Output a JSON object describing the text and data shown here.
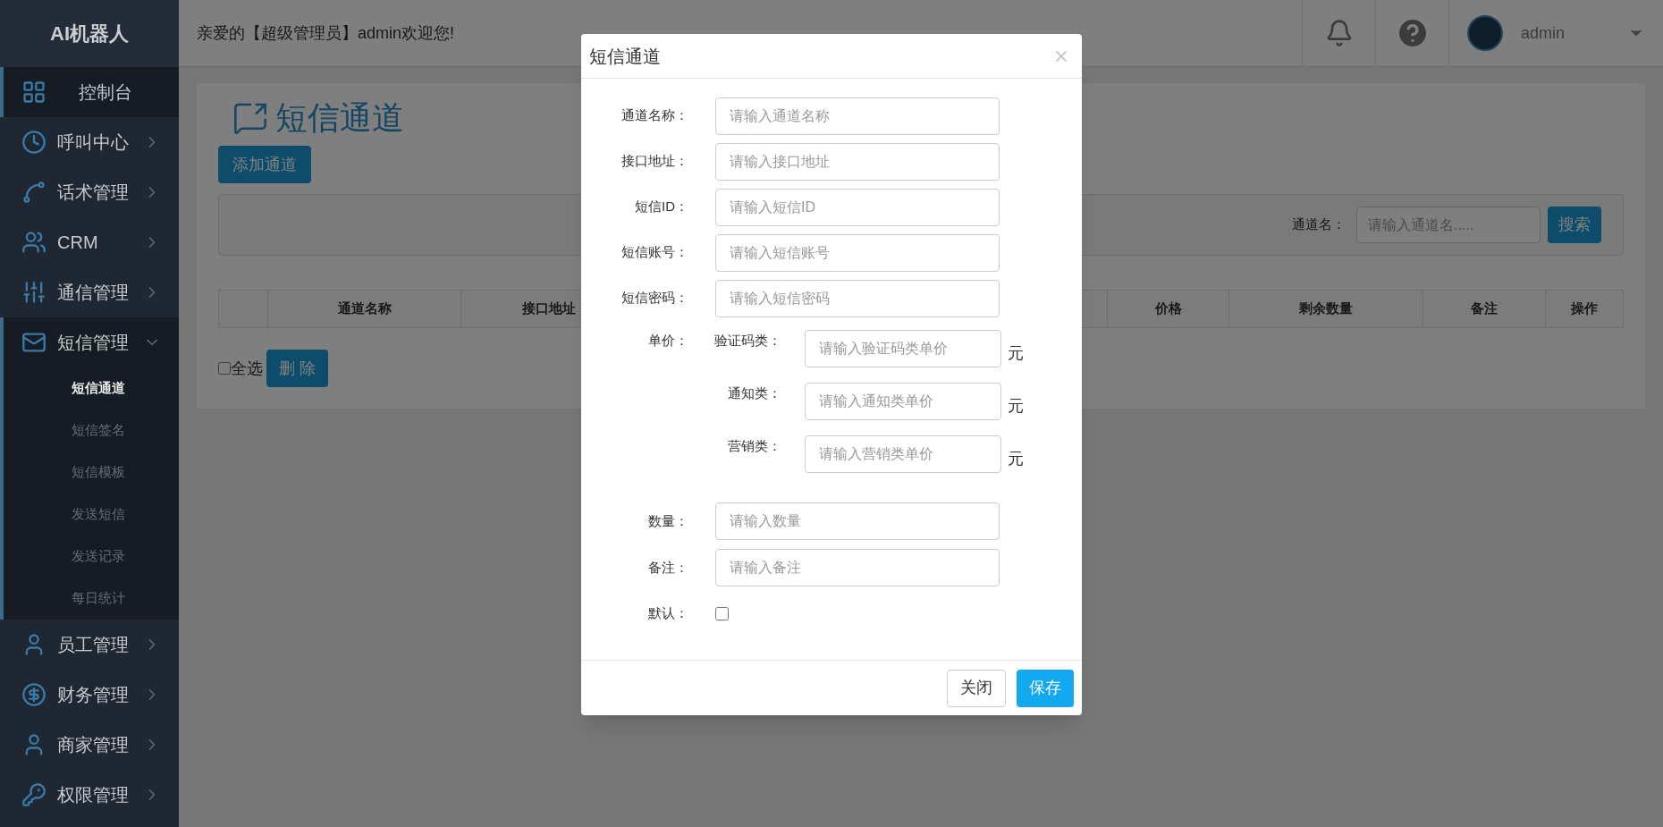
{
  "sidebar": {
    "logo": "AI机器人",
    "items": [
      {
        "label": "控制台",
        "selected": true
      },
      {
        "label": "呼叫中心",
        "selected": false,
        "expanded": false
      },
      {
        "label": "话术管理",
        "selected": false,
        "expanded": false
      },
      {
        "label": "CRM",
        "selected": false,
        "expanded": false
      },
      {
        "label": "通信管理",
        "selected": false,
        "expanded": false
      },
      {
        "label": "短信管理",
        "selected": false,
        "expanded": true,
        "children": [
          {
            "label": "短信通道",
            "selected": true
          },
          {
            "label": "短信签名",
            "selected": false
          },
          {
            "label": "短信模板",
            "selected": false
          },
          {
            "label": "发送短信",
            "selected": false
          },
          {
            "label": "发送记录",
            "selected": false
          },
          {
            "label": "每日统计",
            "selected": false
          }
        ]
      },
      {
        "label": "员工管理",
        "selected": false,
        "expanded": false
      },
      {
        "label": "财务管理",
        "selected": false,
        "expanded": false
      },
      {
        "label": "商家管理",
        "selected": false,
        "expanded": false
      },
      {
        "label": "权限管理",
        "selected": false,
        "expanded": false
      }
    ]
  },
  "header": {
    "greeting": "亲爱的【超级管理员】admin欢迎您!",
    "user": "admin"
  },
  "page": {
    "title": "短信通道",
    "add_button": "添加通道",
    "search": {
      "label": "通道名：",
      "placeholder": "请输入通道名.....",
      "button": "搜索"
    },
    "table": {
      "columns": [
        "通道名称",
        "接口地址",
        "价格",
        "剩余数量",
        "备注",
        "操作"
      ]
    },
    "select_all": {
      "label": "全选",
      "checked": false
    },
    "delete_button": "删 除"
  },
  "modal": {
    "title": "短信通道",
    "fields": [
      {
        "label": "通道名称：",
        "placeholder": "请输入通道名称"
      },
      {
        "label": "接口地址：",
        "placeholder": "请输入接口地址"
      },
      {
        "label": "短信ID：",
        "placeholder": "请输入短信ID"
      },
      {
        "label": "短信账号：",
        "placeholder": "请输入短信账号"
      },
      {
        "label": "短信密码：",
        "placeholder": "请输入短信密码"
      }
    ],
    "price": {
      "label": "单价：",
      "rows": [
        {
          "label": "验证码类：",
          "placeholder": "请输入验证码类单价",
          "unit": "元"
        },
        {
          "label": "通知类：",
          "placeholder": "请输入通知类单价",
          "unit": "元"
        },
        {
          "label": "营销类：",
          "placeholder": "请输入营销类单价",
          "unit": "元"
        }
      ]
    },
    "more_fields": [
      {
        "label": "数量：",
        "placeholder": "请输入数量"
      },
      {
        "label": "备注：",
        "placeholder": "请输入备注"
      }
    ],
    "default": {
      "label": "默认：",
      "checked": false
    },
    "buttons": [
      {
        "label": "关闭",
        "kind": "default"
      },
      {
        "label": "保存",
        "kind": "primary"
      }
    ]
  }
}
